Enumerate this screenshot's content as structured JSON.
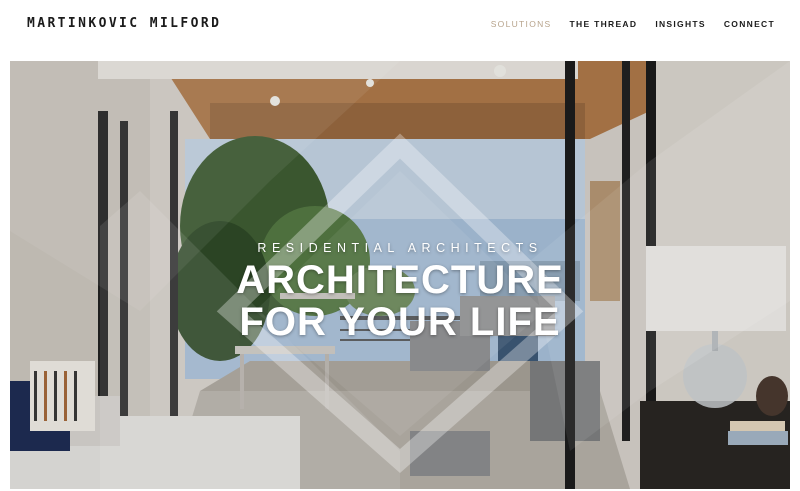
{
  "header": {
    "logo": "MARTINKOVIC MILFORD",
    "nav": [
      {
        "label": "SOLUTIONS",
        "active": true
      },
      {
        "label": "THE THREAD",
        "active": false
      },
      {
        "label": "INSIGHTS",
        "active": false
      },
      {
        "label": "CONNECT",
        "active": false
      }
    ]
  },
  "hero": {
    "eyebrow": "RESIDENTIAL ARCHITECTS",
    "headline_line1": "ARCHITECTURE",
    "headline_line2": "FOR YOUR LIFE"
  },
  "colors": {
    "accent": "#b7a38b",
    "text": "#1b1b1b",
    "hero_text": "#ffffff"
  }
}
